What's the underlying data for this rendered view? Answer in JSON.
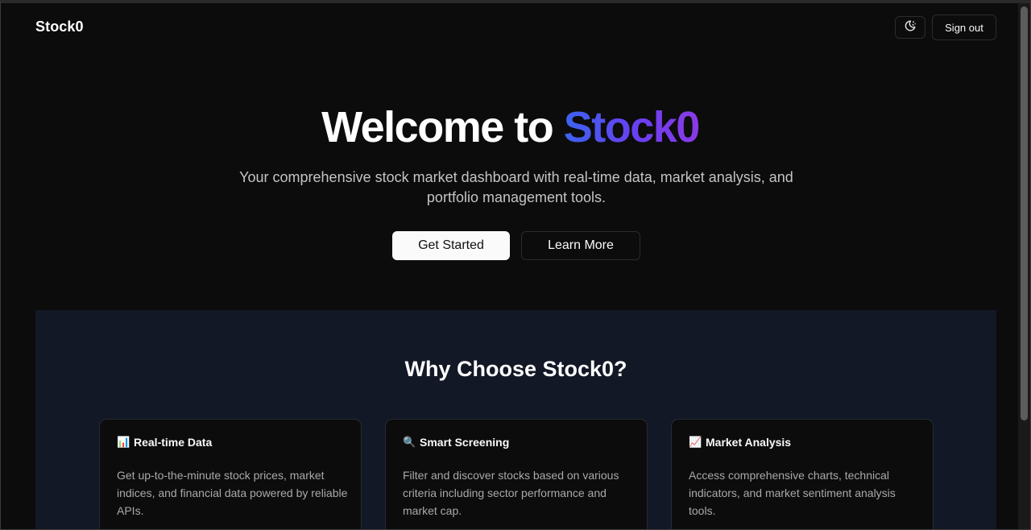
{
  "header": {
    "brand": "Stock0",
    "theme_toggle_icon": "moon-sun-icon",
    "signout_label": "Sign out"
  },
  "hero": {
    "title_prefix": "Welcome to ",
    "title_accent": "Stock0",
    "subtitle": "Your comprehensive stock market dashboard with real-time data, market analysis, and portfolio management tools.",
    "primary_button": "Get Started",
    "secondary_button": "Learn More"
  },
  "features": {
    "title": "Why Choose Stock0?",
    "cards": [
      {
        "icon": "bar-chart-icon",
        "emoji": "📊",
        "title": "Real-time Data",
        "description": "Get up-to-the-minute stock prices, market indices, and financial data powered by reliable APIs."
      },
      {
        "icon": "magnifier-icon",
        "emoji": "🔍",
        "title": "Smart Screening",
        "description": "Filter and discover stocks based on various criteria including sector performance and market cap."
      },
      {
        "icon": "trending-up-icon",
        "emoji": "📈",
        "title": "Market Analysis",
        "description": "Access comprehensive charts, technical indicators, and market sentiment analysis tools."
      }
    ]
  },
  "colors": {
    "background": "#0c0c0c",
    "section_background": "#131826",
    "accent_start": "#3b63f0",
    "accent_end": "#8b3ae6"
  }
}
